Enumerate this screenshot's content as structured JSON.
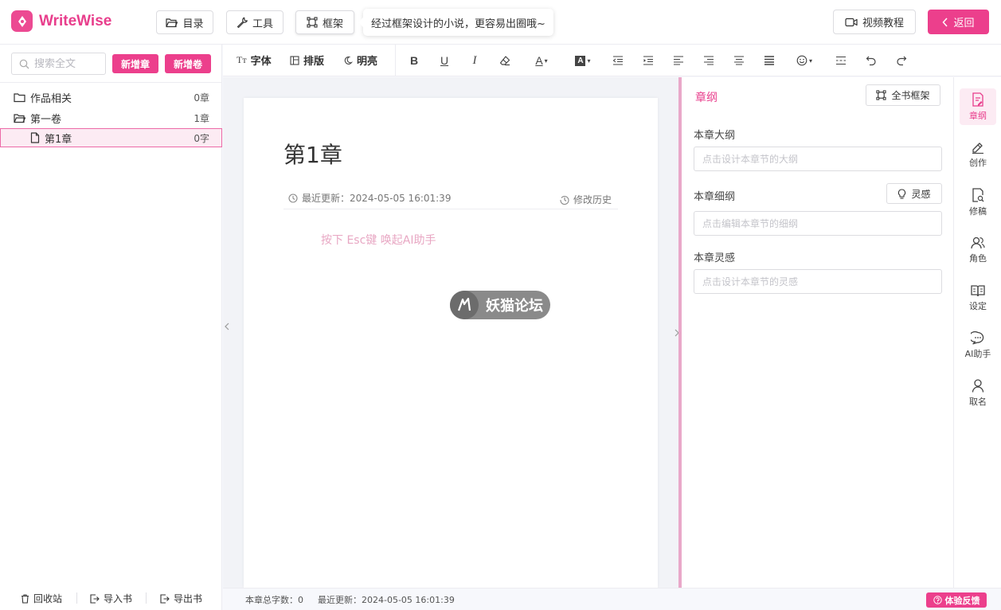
{
  "app": {
    "name": "WriteWise",
    "brand_color": "#ec3f8c"
  },
  "header": {
    "catalog_label": "目录",
    "tools_label": "工具",
    "frame_label": "框架",
    "frame_tip": "经过框架设计的小说，更容易出圈哦~",
    "video_label": "视频教程",
    "back_label": "返回"
  },
  "sidebar": {
    "search_placeholder": "搜索全文",
    "new_chapter_label": "新增章",
    "new_volume_label": "新增卷",
    "tree": [
      {
        "name": "作品相关",
        "count": "0章",
        "icon": "folder-icon"
      },
      {
        "name": "第一卷",
        "count": "1章",
        "icon": "folder-open-icon"
      },
      {
        "name": "第1章",
        "count": "0字",
        "icon": "file-icon"
      }
    ],
    "footer": {
      "recycle_label": "回收站",
      "import_label": "导入书",
      "export_label": "导出书"
    }
  },
  "toolbar": {
    "font_label": "字体",
    "layout_label": "排版",
    "theme_label": "明亮"
  },
  "editor": {
    "chapter_title": "第1章",
    "last_update": "最近更新：2024-05-05 16:01:39",
    "history_label": "修改历史",
    "hint": "按下 Esc键 唤起AI助手",
    "watermark_text": "妖猫论坛"
  },
  "outline": {
    "title": "章纲",
    "full_frame_label": "全书框架",
    "fields": [
      {
        "label": "本章大纲",
        "placeholder": "点击设计本章节的大纲"
      },
      {
        "label": "本章细纲",
        "placeholder": "点击编辑本章节的细纲"
      },
      {
        "label": "本章灵感",
        "placeholder": "点击设计本章节的灵感"
      }
    ],
    "inspiration_label": "灵感"
  },
  "rail": {
    "items": [
      {
        "label": "章纲",
        "icon": "outline-doc-icon",
        "active": true
      },
      {
        "label": "创作",
        "icon": "pen-icon",
        "active": false
      },
      {
        "label": "修稿",
        "icon": "doc-search-icon",
        "active": false
      },
      {
        "label": "角色",
        "icon": "people-icon",
        "active": false
      },
      {
        "label": "设定",
        "icon": "book-icon",
        "active": false
      },
      {
        "label": "AI助手",
        "icon": "chat-icon",
        "active": false
      },
      {
        "label": "取名",
        "icon": "person-icon",
        "active": false
      }
    ]
  },
  "status": {
    "word_count": "本章总字数：0",
    "last_update": "最近更新：2024-05-05 16:01:39",
    "feedback_label": "体验反馈"
  }
}
